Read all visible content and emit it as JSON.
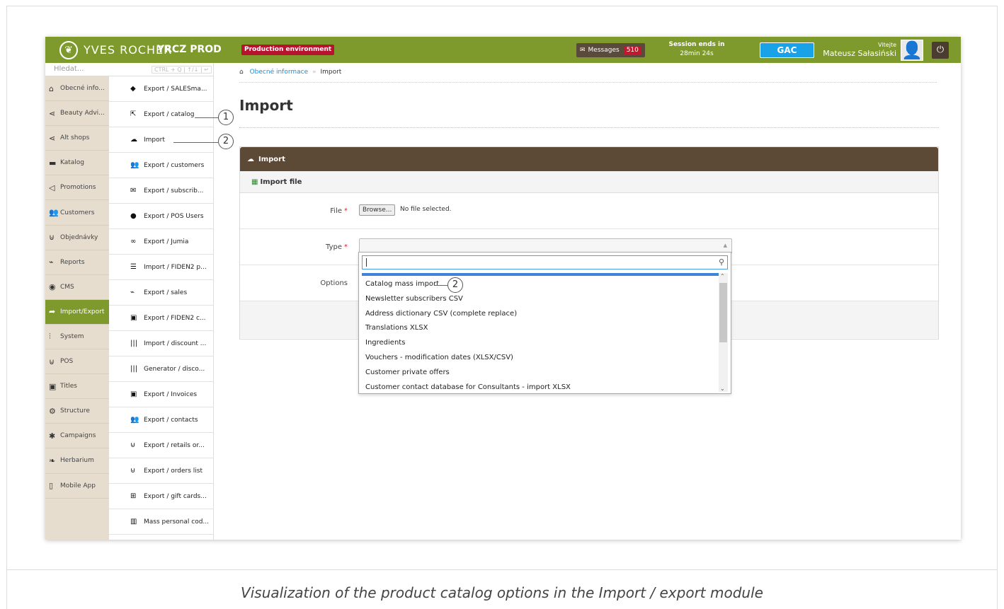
{
  "header": {
    "brand": "YVES ROCHER",
    "logo_icon": "leaf-icon",
    "environment_name": "YRCZ PROD",
    "environment_badge": "Production environment",
    "messages_label": "Messages",
    "messages_count": "510",
    "session_label": "Session ends in",
    "session_time": "28min 24s",
    "gac_label": "GAC",
    "greeting": "Vitejte",
    "user_name": "Mateusz Sałasiński",
    "power_icon": "power-icon",
    "brand_color": "#7f9a2c",
    "badge_color": "#b5132e",
    "gac_color": "#1aa2e8"
  },
  "sidebar": {
    "search_placeholder": "Hledat...",
    "search_shortcut": "CTRL + Q | ↑/↓ | ↵",
    "items": [
      {
        "label": "Obecné info...",
        "icon": "home-icon"
      },
      {
        "label": "Beauty Advi...",
        "icon": "share-icon"
      },
      {
        "label": "Alt shops",
        "icon": "share-icon"
      },
      {
        "label": "Katalog",
        "icon": "folder-icon"
      },
      {
        "label": "Promotions",
        "icon": "megaphone-icon"
      },
      {
        "label": "Customers",
        "icon": "users-icon"
      },
      {
        "label": "Objednávky",
        "icon": "cart-icon"
      },
      {
        "label": "Reports",
        "icon": "chart-icon"
      },
      {
        "label": "CMS",
        "icon": "globe-icon"
      },
      {
        "label": "Import/Export",
        "icon": "share-arrow-icon",
        "active": true
      },
      {
        "label": "System",
        "icon": "sliders-icon"
      },
      {
        "label": "POS",
        "icon": "cart-icon"
      },
      {
        "label": "Titles",
        "icon": "id-card-icon"
      },
      {
        "label": "Structure",
        "icon": "sitemap-icon"
      },
      {
        "label": "Campaigns",
        "icon": "asterisk-icon"
      },
      {
        "label": "Herbarium",
        "icon": "leaf-icon"
      },
      {
        "label": "Mobile App",
        "icon": "mobile-icon"
      }
    ]
  },
  "submenu": {
    "shortcut": "CTRL + Q | ↑/↓ | ↵",
    "items": [
      {
        "label": "Export / SALESma...",
        "icon": "tag-icon"
      },
      {
        "label": "Export / catalog",
        "icon": "external-link-icon"
      },
      {
        "label": "Import",
        "icon": "cloud-upload-icon"
      },
      {
        "label": "Export / customers",
        "icon": "users-icon"
      },
      {
        "label": "Export / subscrib...",
        "icon": "envelope-icon"
      },
      {
        "label": "Export / POS Users",
        "icon": "user-icon"
      },
      {
        "label": "Export / Jumia",
        "icon": "link-icon"
      },
      {
        "label": "Import / FIDEN2 p...",
        "icon": "list-icon"
      },
      {
        "label": "Export / sales",
        "icon": "chart-icon"
      },
      {
        "label": "Export / FIDEN2 c...",
        "icon": "id-card-icon"
      },
      {
        "label": "Import / discount ...",
        "icon": "barcode-icon"
      },
      {
        "label": "Generator / disco...",
        "icon": "barcode-icon"
      },
      {
        "label": "Export / Invoices",
        "icon": "id-card-icon"
      },
      {
        "label": "Export / contacts",
        "icon": "users-icon"
      },
      {
        "label": "Export / retails or...",
        "icon": "cart-icon"
      },
      {
        "label": "Export / orders list",
        "icon": "cart-icon"
      },
      {
        "label": "Export / gift cards...",
        "icon": "gift-icon"
      },
      {
        "label": "Mass personal cod...",
        "icon": "trash-icon"
      }
    ]
  },
  "breadcrumb": {
    "home_icon": "home-icon",
    "link": "Obecné informace",
    "separator": "»",
    "current": "Import"
  },
  "page": {
    "title": "Import",
    "panel_title": "Import",
    "panel_icon": "cloud-upload-icon",
    "subpanel_title": "Import file",
    "subpanel_icon": "excel-file-icon",
    "file_label": "File",
    "required_mark": "*",
    "browse_label": "Browse...",
    "no_file_text": "No file selected.",
    "type_label": "Type",
    "options_label": "Options"
  },
  "type_dropdown": {
    "search_value": "",
    "options": [
      "Catalog mass import",
      "Newsletter subscribers CSV",
      "Address dictionary CSV (complete replace)",
      "Translations XLSX",
      "Ingredients",
      "Vouchers - modification dates (XLSX/CSV)",
      "Customer private offers",
      "Customer contact database for Consultants - import XLSX"
    ]
  },
  "callouts": [
    "1",
    "2",
    "2"
  ],
  "caption": "Visualization of the product catalog options in the Import / export module"
}
